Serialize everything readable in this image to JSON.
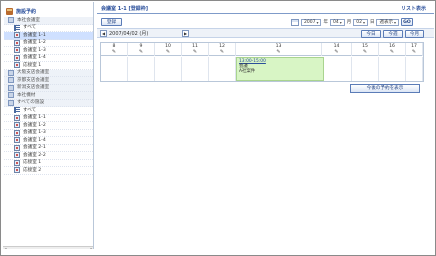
{
  "sidebar": {
    "header": "施設予約",
    "items": [
      {
        "label": "本社会議室",
        "kind": "group",
        "icon": "folder-icon"
      },
      {
        "label": "すべて",
        "kind": "all",
        "icon": "list-icon"
      },
      {
        "label": "会議室 1-1",
        "kind": "room",
        "icon": "room-icon",
        "selected": true
      },
      {
        "label": "会議室 1-2",
        "kind": "room",
        "icon": "room-icon"
      },
      {
        "label": "会議室 1-3",
        "kind": "room",
        "icon": "room-icon"
      },
      {
        "label": "会議室 1-4",
        "kind": "room",
        "icon": "room-icon"
      },
      {
        "label": "応接室 1",
        "kind": "room",
        "icon": "room-icon"
      },
      {
        "label": "大阪支店会議室",
        "kind": "group",
        "icon": "folder-icon"
      },
      {
        "label": "京都支店会議室",
        "kind": "group",
        "icon": "folder-icon"
      },
      {
        "label": "新潟支店会議室",
        "kind": "group",
        "icon": "folder-icon"
      },
      {
        "label": "本社機材",
        "kind": "group",
        "icon": "folder-icon"
      },
      {
        "label": "すべての施設",
        "kind": "group",
        "icon": "folder-icon"
      },
      {
        "label": "すべて",
        "kind": "all",
        "icon": "list-icon"
      },
      {
        "label": "会議室 1-1",
        "kind": "room",
        "icon": "room-icon"
      },
      {
        "label": "会議室 1-2",
        "kind": "room",
        "icon": "room-icon"
      },
      {
        "label": "会議室 1-3",
        "kind": "room",
        "icon": "room-icon"
      },
      {
        "label": "会議室 1-4",
        "kind": "room",
        "icon": "room-icon"
      },
      {
        "label": "会議室 2-1",
        "kind": "room",
        "icon": "room-icon"
      },
      {
        "label": "会議室 2-2",
        "kind": "room",
        "icon": "room-icon"
      },
      {
        "label": "応接室 1",
        "kind": "room",
        "icon": "room-icon"
      },
      {
        "label": "応接室 2",
        "kind": "room",
        "icon": "room-icon"
      }
    ]
  },
  "main": {
    "title": "会議室 1-1 [登録枠]",
    "list_view_link": "リスト表示",
    "register_button": "登録",
    "year_value": "2007",
    "year_unit": "年",
    "month_value": "04",
    "month_unit": "月",
    "day_value": "02",
    "day_unit": "日",
    "mode_value": "週表示",
    "go_button": "GO",
    "current_date": "2007/04/02 (月)",
    "today_button": "今日",
    "this_month_button": "今週",
    "next_button": "今月",
    "days": [
      "8",
      "9",
      "10",
      "11",
      "12",
      "13",
      "14",
      "15",
      "16",
      "17"
    ],
    "event": {
      "time": "13:00-15:00",
      "line1": "会議",
      "line2": "A社案件"
    },
    "footer_button": "今後の予約を表示"
  }
}
